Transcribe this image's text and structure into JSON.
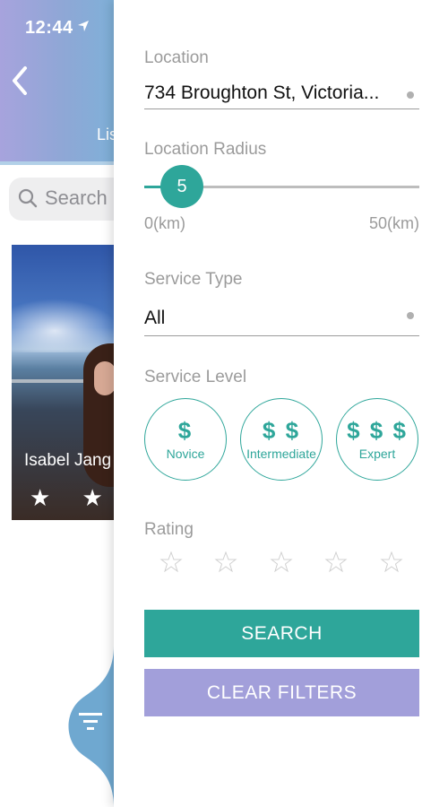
{
  "background": {
    "status_time": "12:44",
    "tab_peek": "Lis",
    "search_label": "Search",
    "card": {
      "name": "Isabel Jang",
      "stars": "★ ★ ★",
      "rating_stars": 3
    }
  },
  "drawer": {
    "location": {
      "label": "Location",
      "value": "734 Broughton St, Victoria..."
    },
    "radius": {
      "label": "Location Radius",
      "value": "5",
      "min_label": "0(km)",
      "max_label": "50(km)",
      "min": 0,
      "max": 50
    },
    "service_type": {
      "label": "Service Type",
      "value": "All"
    },
    "service_level": {
      "label": "Service Level",
      "options": [
        {
          "symbol": "$",
          "name": "Novice"
        },
        {
          "symbol": "$ $",
          "name": "Intermediate"
        },
        {
          "symbol": "$ $ $",
          "name": "Expert"
        }
      ]
    },
    "rating": {
      "label": "Rating",
      "value": 0,
      "max": 5
    },
    "buttons": {
      "search": "SEARCH",
      "clear": "CLEAR FILTERS"
    }
  },
  "colors": {
    "accent": "#2ea69a",
    "secondary": "#a29fda",
    "header_start": "#a7a3dd",
    "header_end": "#7fb0d8"
  }
}
